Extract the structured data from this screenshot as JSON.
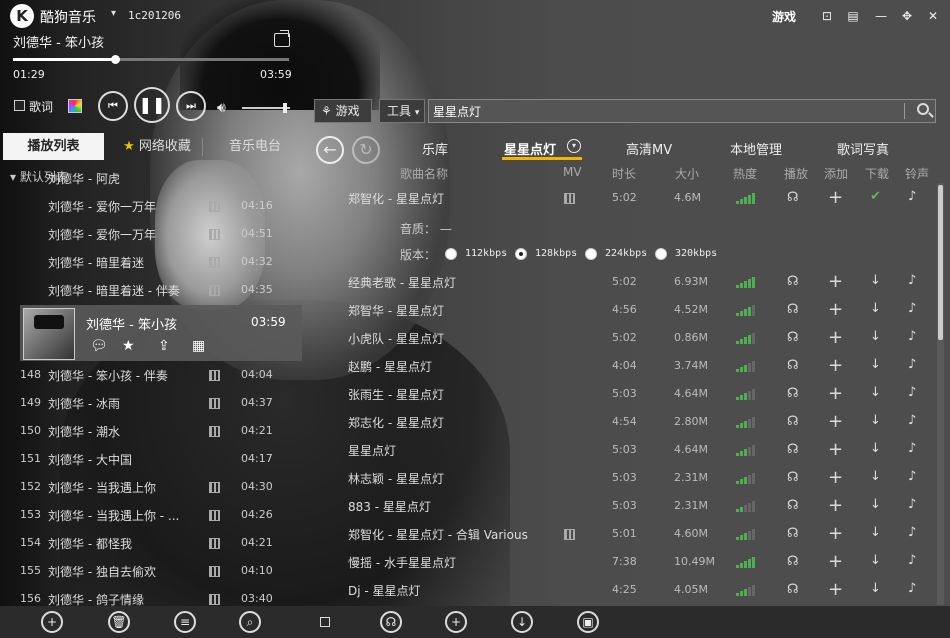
{
  "titlebar": {
    "logo": "K",
    "app_name": "酷狗音乐",
    "user_id": "1c201206",
    "games_label": "游戏",
    "window_controls": [
      "mini-mode-icon",
      "skin-icon",
      "minimize-icon",
      "maximize-icon",
      "close-icon"
    ]
  },
  "now_playing": {
    "title": "刘德华 - 笨小孩",
    "current_time": "01:29",
    "total_time": "03:59",
    "progress": 0.37,
    "volume": 0.9
  },
  "controls": {
    "lyrics_label": "歌词",
    "lyrics_checked": false
  },
  "toolbar": {
    "game_label": "游戏",
    "tools_label": "工具",
    "search_value": "星星点灯"
  },
  "left_tabs": [
    "播放列表",
    "网络收藏",
    "音乐电台"
  ],
  "left_active_tab": 0,
  "playlist": {
    "group_head": "默认列表",
    "rows": [
      {
        "num": "",
        "name": "刘德华 - 阿虎",
        "mv": false,
        "dur": ""
      },
      {
        "num": "",
        "name": "刘德华 - 爱你一万年",
        "mv": true,
        "dur": "04:16"
      },
      {
        "num": "",
        "name": "刘德华 - 爱你一万年",
        "mv": true,
        "dur": "04:51"
      },
      {
        "num": "",
        "name": "刘德华 - 暗里着迷",
        "mv": true,
        "dur": "04:32"
      },
      {
        "num": "",
        "name": "刘德华 - 暗里着迷 - 伴奏",
        "mv": true,
        "dur": "04:35"
      }
    ],
    "playing": {
      "title": "刘德华 - 笨小孩",
      "dur": "03:59"
    },
    "rows_after": [
      {
        "num": "148",
        "name": "刘德华 - 笨小孩 - 伴奏",
        "mv": true,
        "dur": "04:04"
      },
      {
        "num": "149",
        "name": "刘德华 - 冰雨",
        "mv": true,
        "dur": "04:37"
      },
      {
        "num": "150",
        "name": "刘德华 - 潮水",
        "mv": true,
        "dur": "04:21"
      },
      {
        "num": "151",
        "name": "刘德华 - 大中国",
        "mv": false,
        "dur": "04:17"
      },
      {
        "num": "152",
        "name": "刘德华 - 当我遇上你",
        "mv": true,
        "dur": "04:30"
      },
      {
        "num": "153",
        "name": "刘德华 - 当我遇上你 - ...",
        "mv": true,
        "dur": "04:26"
      },
      {
        "num": "154",
        "name": "刘德华 - 都怪我",
        "mv": true,
        "dur": "04:21"
      },
      {
        "num": "155",
        "name": "刘德华 - 独自去偷欢",
        "mv": true,
        "dur": "04:10"
      },
      {
        "num": "156",
        "name": "刘德华 - 鸽子情缘",
        "mv": true,
        "dur": "03:40"
      }
    ]
  },
  "right_tabs": [
    "乐库",
    "星星点灯",
    "高清MV",
    "本地管理",
    "歌词写真"
  ],
  "right_active_tab": 1,
  "columns": [
    "歌曲名称",
    "MV",
    "时长",
    "大小",
    "热度",
    "播放",
    "添加",
    "下载",
    "铃声"
  ],
  "expanded": {
    "quality_label": "音质：",
    "quality_value": "—",
    "version_label": "版本：",
    "bitrates": [
      "112kbps",
      "128kbps",
      "224kbps",
      "320kbps"
    ],
    "selected_bitrate": 1
  },
  "results": [
    {
      "name": "郑智化 - 星星点灯",
      "mv": true,
      "dur": "5:02",
      "size": "4.6M",
      "heat": 5,
      "downloaded": true
    },
    {
      "name": "经典老歌 - 星星点灯",
      "mv": false,
      "dur": "5:02",
      "size": "6.93M",
      "heat": 5,
      "downloaded": false
    },
    {
      "name": "郑智华 - 星星点灯",
      "mv": false,
      "dur": "4:56",
      "size": "4.52M",
      "heat": 4,
      "downloaded": false
    },
    {
      "name": "小虎队 - 星星点灯",
      "mv": false,
      "dur": "5:02",
      "size": "0.86M",
      "heat": 4,
      "downloaded": false
    },
    {
      "name": "赵鹏 - 星星点灯",
      "mv": false,
      "dur": "4:04",
      "size": "3.74M",
      "heat": 3,
      "downloaded": false
    },
    {
      "name": "张雨生 - 星星点灯",
      "mv": false,
      "dur": "5:03",
      "size": "4.64M",
      "heat": 3,
      "downloaded": false
    },
    {
      "name": "郑志化 - 星星点灯",
      "mv": false,
      "dur": "4:54",
      "size": "2.80M",
      "heat": 3,
      "downloaded": false
    },
    {
      "name": "星星点灯",
      "mv": false,
      "dur": "5:03",
      "size": "4.64M",
      "heat": 3,
      "downloaded": false
    },
    {
      "name": "林志颖 - 星星点灯",
      "mv": false,
      "dur": "5:03",
      "size": "2.31M",
      "heat": 3,
      "downloaded": false
    },
    {
      "name": "883 - 星星点灯",
      "mv": false,
      "dur": "5:03",
      "size": "2.31M",
      "heat": 2,
      "downloaded": false
    },
    {
      "name": "郑智化 - 星星点灯 - 合辑 Various",
      "mv": true,
      "dur": "5:01",
      "size": "4.60M",
      "heat": 3,
      "downloaded": false
    },
    {
      "name": "慢摇 - 水手星星点灯",
      "mv": false,
      "dur": "7:38",
      "size": "10.49M",
      "heat": 5,
      "downloaded": false
    },
    {
      "name": "Dj - 星星点灯",
      "mv": false,
      "dur": "4:25",
      "size": "4.05M",
      "heat": 3,
      "downloaded": false
    }
  ],
  "bottom_left": [
    "add-icon",
    "delete-icon",
    "sort-icon",
    "search-icon"
  ],
  "bottom_right": [
    "select-all-icon",
    "headphones-icon",
    "add-icon",
    "download-icon",
    "save-icon"
  ],
  "colors": {
    "accent": "#f4b400",
    "heat": "#4caf50",
    "check": "#5cb85c"
  }
}
